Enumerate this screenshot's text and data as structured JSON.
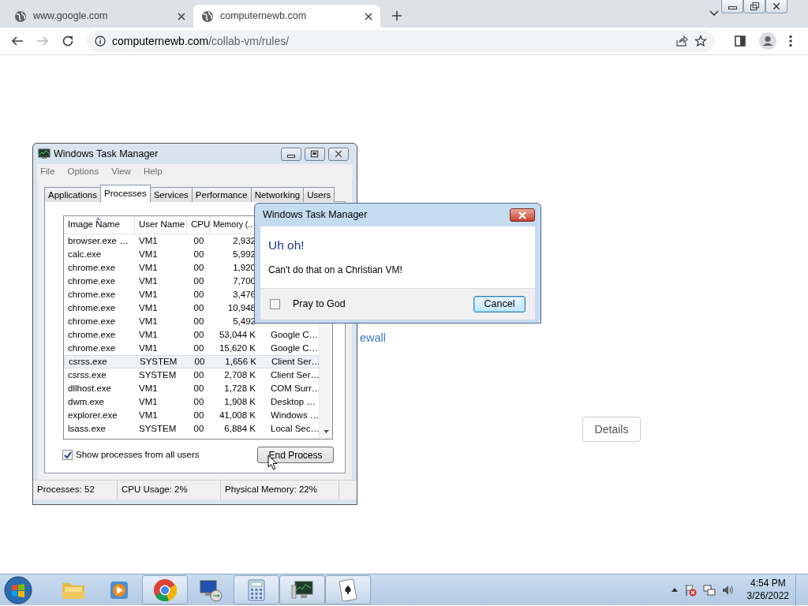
{
  "browser": {
    "tabs": [
      {
        "label": "www.google.com",
        "selected": false
      },
      {
        "label": "computernewb.com",
        "selected": true
      }
    ],
    "address": {
      "host": "computernewb.com",
      "path": "/collab-vm/rules/"
    }
  },
  "page": {
    "link": "ewall",
    "details_button": "Details"
  },
  "task_manager": {
    "title": "Windows Task Manager",
    "menu": [
      "File",
      "Options",
      "View",
      "Help"
    ],
    "tabs": [
      {
        "label": "Applications",
        "selected": false
      },
      {
        "label": "Processes",
        "selected": true
      },
      {
        "label": "Services",
        "selected": false
      },
      {
        "label": "Performance",
        "selected": false
      },
      {
        "label": "Networking",
        "selected": false
      },
      {
        "label": "Users",
        "selected": false
      }
    ],
    "columns": [
      "Image Name",
      "User Name",
      "CPU",
      "Memory (.."
    ],
    "rows": [
      {
        "cells": [
          "browser.exe …",
          "VM1",
          "00",
          "2,932"
        ],
        "selected": false
      },
      {
        "cells": [
          "calc.exe",
          "VM1",
          "00",
          "5,992"
        ],
        "selected": false
      },
      {
        "cells": [
          "chrome.exe",
          "VM1",
          "00",
          "1,920"
        ],
        "selected": false
      },
      {
        "cells": [
          "chrome.exe",
          "VM1",
          "00",
          "7,700"
        ],
        "selected": false
      },
      {
        "cells": [
          "chrome.exe",
          "VM1",
          "00",
          "3,476"
        ],
        "selected": false
      },
      {
        "cells": [
          "chrome.exe",
          "VM1",
          "00",
          "10,948"
        ],
        "selected": false
      },
      {
        "cells": [
          "chrome.exe",
          "VM1",
          "00",
          "5,492"
        ],
        "selected": false
      },
      {
        "cells": [
          "chrome.exe",
          "VM1",
          "00",
          "53,044 K",
          "Google C…"
        ],
        "selected": false
      },
      {
        "cells": [
          "chrome.exe",
          "VM1",
          "00",
          "15,620 K",
          "Google C…"
        ],
        "selected": false
      },
      {
        "cells": [
          "csrss.exe",
          "SYSTEM",
          "00",
          "1,656 K",
          "Client Ser…"
        ],
        "selected": true
      },
      {
        "cells": [
          "csrss.exe",
          "SYSTEM",
          "00",
          "2,708 K",
          "Client Ser…"
        ],
        "selected": false
      },
      {
        "cells": [
          "dllhost.exe",
          "VM1",
          "00",
          "1,728 K",
          "COM Surr…"
        ],
        "selected": false
      },
      {
        "cells": [
          "dwm.exe",
          "VM1",
          "00",
          "1,908 K",
          "Desktop …"
        ],
        "selected": false
      },
      {
        "cells": [
          "explorer.exe",
          "VM1",
          "00",
          "41,008 K",
          "Windows …"
        ],
        "selected": false
      },
      {
        "cells": [
          "lsass.exe",
          "SYSTEM",
          "00",
          "6,884 K",
          "Local Sec…"
        ],
        "selected": false
      }
    ],
    "show_all": {
      "label": "Show processes from all users",
      "checked": true
    },
    "end_button": "End Process",
    "status": [
      "Processes: 52",
      "CPU Usage: 2%",
      "Physical Memory: 22%"
    ]
  },
  "dialog": {
    "title": "Windows Task Manager",
    "heading": "Uh oh!",
    "message": "Can't do that on a Christian VM!",
    "checkbox": {
      "label": "Pray to God",
      "checked": false
    },
    "button": "Cancel"
  },
  "taskbar": {
    "time": "4:54 PM",
    "date": "3/26/2022"
  }
}
